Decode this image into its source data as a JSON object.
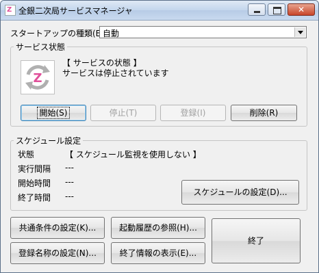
{
  "window": {
    "title": "全銀二次局サービスマネージャ",
    "close_glyph": "✕"
  },
  "startup": {
    "label": "スタートアップの種類(E):",
    "value": "自動"
  },
  "service": {
    "group_title": "サービス状態",
    "status_heading": "【 サービスの状態 】",
    "status_text": "サービスは停止されています",
    "buttons": {
      "start": "開始(S)",
      "stop": "停止(T)",
      "register": "登録(I)",
      "delete": "削除(R)"
    }
  },
  "schedule": {
    "group_title": "スケジュール設定",
    "rows": [
      {
        "label": "状態",
        "value": "【 スケジュール監視を使用しない 】"
      },
      {
        "label": "実行間隔",
        "value": "---"
      },
      {
        "label": "開始時間",
        "value": "---"
      },
      {
        "label": "終了時間",
        "value": "---"
      }
    ],
    "settings_button": "スケジュールの設定(D)..."
  },
  "bottom_buttons": {
    "common": "共通条件の設定(K)...",
    "history": "起動履歴の参照(H)...",
    "exit": "終了",
    "regname": "登録名称の設定(N)...",
    "endinfo": "終了情報の表示(E)..."
  },
  "colors": {
    "icon_accent": "#e0509a",
    "icon_arrows": "#a6a6a6"
  },
  "icons": {
    "app": "zengin-app-icon",
    "service": "service-refresh-icon"
  }
}
